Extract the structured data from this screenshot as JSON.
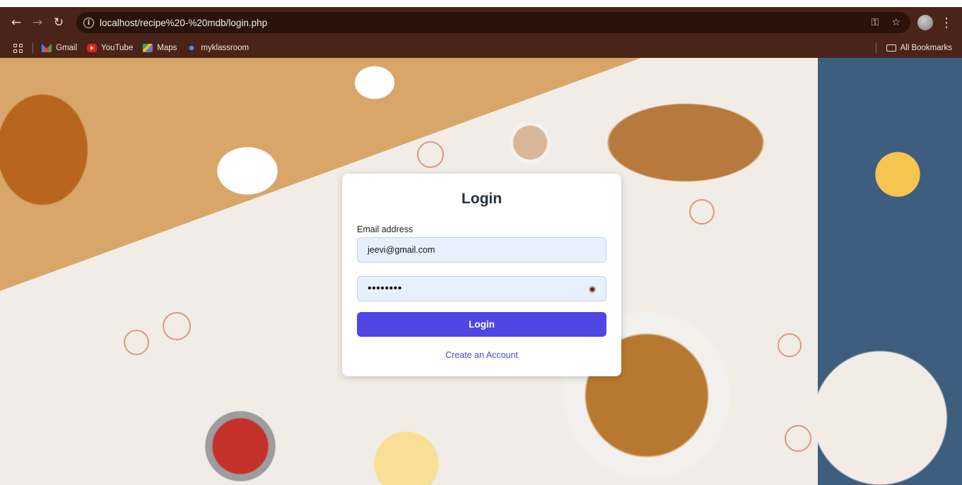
{
  "browser": {
    "url": "localhost/recipe%20-%20mdb/login.php",
    "bookmarks": [
      "Gmail",
      "YouTube",
      "Maps",
      "myklassroom"
    ],
    "all_bookmarks": "All Bookmarks"
  },
  "login": {
    "title": "Login",
    "email_label": "Email address",
    "email_value": "jeevi@gmail.com",
    "password_mask": "••••••••",
    "submit_label": "Login",
    "create_account": "Create an Account"
  },
  "colors": {
    "primary": "#4f46e5",
    "input_bg": "#e8f0fe",
    "chrome_bg": "#4a2418"
  },
  "icons": [
    "back-arrow-icon",
    "forward-arrow-icon",
    "reload-icon",
    "info-icon",
    "key-icon",
    "star-icon",
    "avatar",
    "menu-icon",
    "apps-icon",
    "folder-icon",
    "eye-icon"
  ]
}
